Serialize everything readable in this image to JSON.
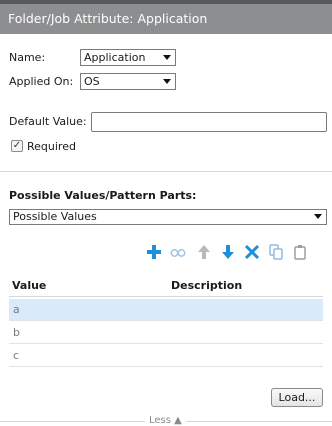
{
  "title": "Folder/Job Attribute: Application",
  "name_label": "Name:",
  "name_value": "Application",
  "applied_label": "Applied On:",
  "applied_value": "OS",
  "default_label": "Default Value:",
  "default_value": "",
  "required_label": "Required",
  "required_checked": true,
  "check_glyph": "✓",
  "possible_title": "Possible Values/Pattern Parts:",
  "possible_type": "Possible Values",
  "toolbar": [
    {
      "icon": "add-icon",
      "color": "#1f8fd8"
    },
    {
      "icon": "rename-icon",
      "color": "#9cc6ea"
    },
    {
      "icon": "move-up-icon",
      "color": "#b9b9b9"
    },
    {
      "icon": "move-down-icon",
      "color": "#1f8fd8"
    },
    {
      "icon": "delete-icon",
      "color": "#1f8fd8"
    },
    {
      "icon": "copy-icon",
      "color": "#8fbce3"
    },
    {
      "icon": "paste-icon",
      "color": "#9e9e9e"
    }
  ],
  "grid": {
    "headers": {
      "value": "Value",
      "description": "Description"
    },
    "rows": [
      {
        "value": "a",
        "description": "",
        "selected": true
      },
      {
        "value": "b",
        "description": "",
        "selected": false
      },
      {
        "value": "c",
        "description": "",
        "selected": false
      }
    ]
  },
  "load_label": "Load...",
  "less_label": "Less"
}
